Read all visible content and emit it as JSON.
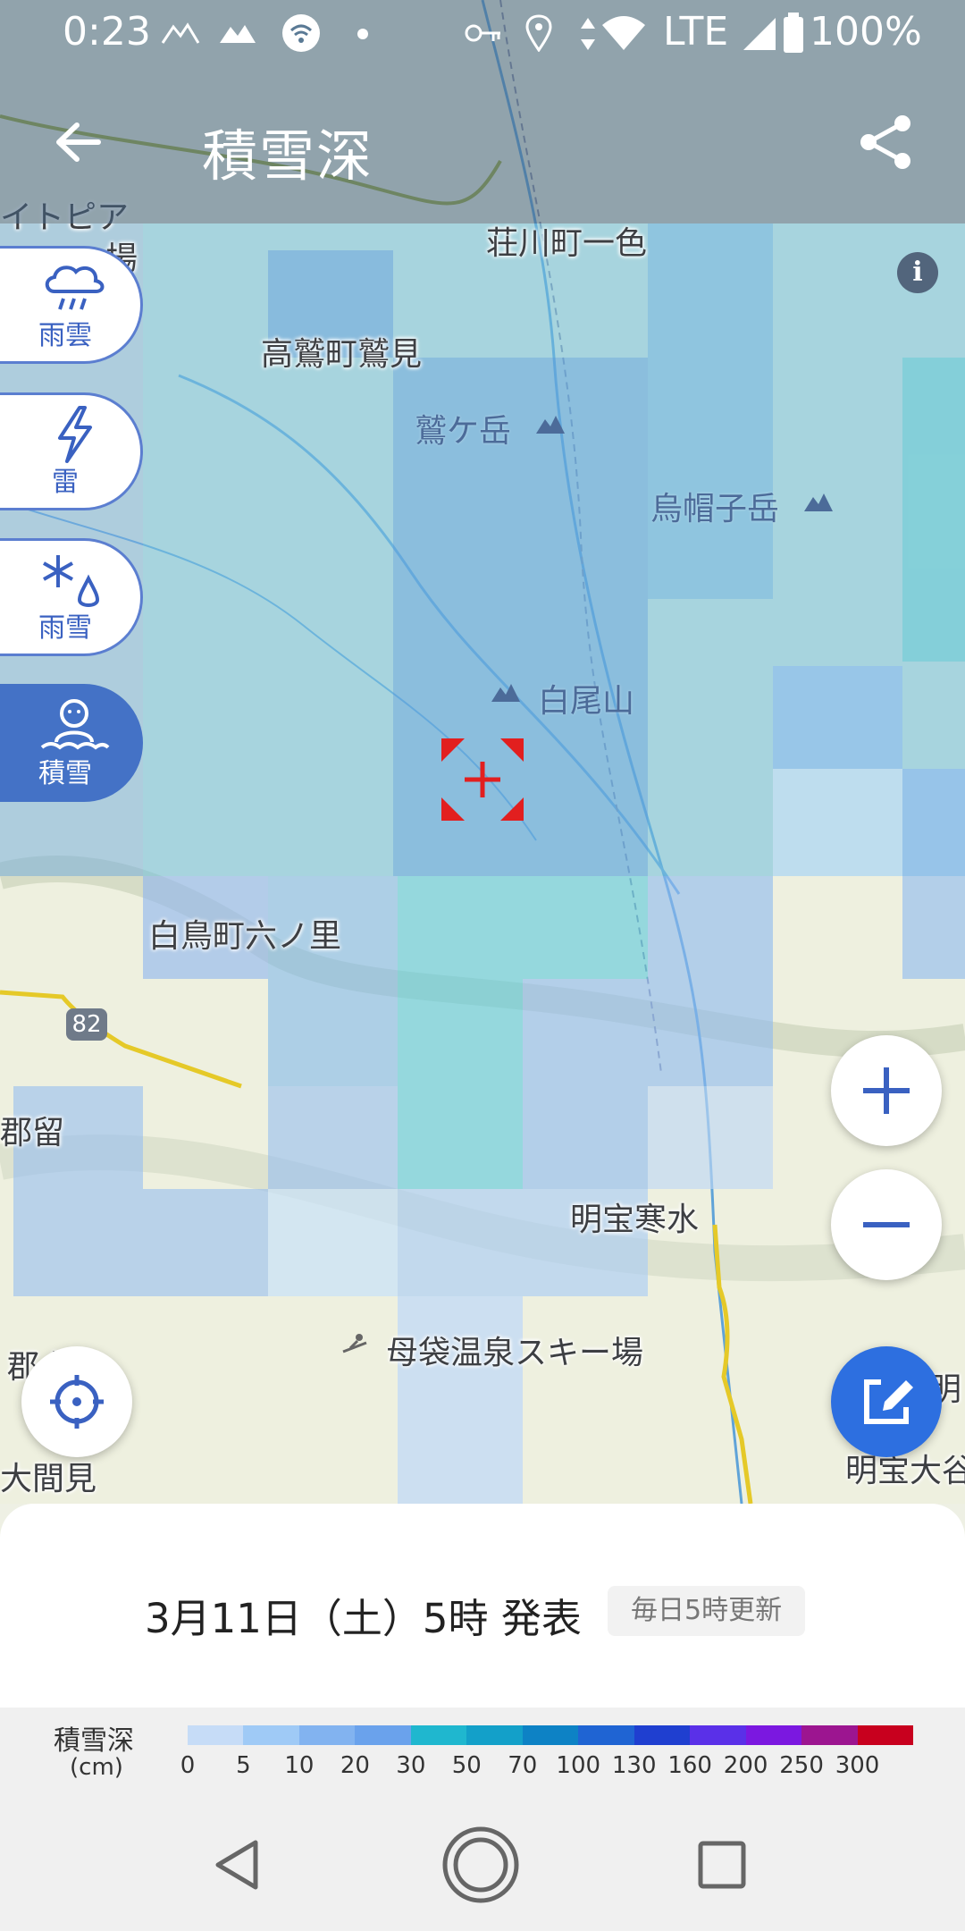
{
  "status_bar": {
    "time": "0:23",
    "network": "LTE",
    "battery": "100%"
  },
  "header": {
    "title": "積雪深"
  },
  "map_labels": [
    {
      "text": "荘川町一色",
      "type": "town"
    },
    {
      "text": "高鷲町鷲見",
      "type": "town"
    },
    {
      "text": "鷲ケ岳",
      "type": "peak"
    },
    {
      "text": "烏帽子岳",
      "type": "peak"
    },
    {
      "text": "白尾山",
      "type": "peak"
    },
    {
      "text": "白鳥町六ノ里",
      "type": "town"
    },
    {
      "text": "明宝寒水",
      "type": "town"
    },
    {
      "text": "母袋温泉スキー場",
      "type": "town"
    },
    {
      "text": "郡留",
      "type": "town"
    },
    {
      "text": "郡上",
      "type": "town"
    },
    {
      "text": "大間見",
      "type": "town"
    },
    {
      "text": "明宝大谷",
      "type": "town"
    },
    {
      "text": "明",
      "type": "town"
    },
    {
      "text": "イトピア",
      "type": "town"
    },
    {
      "text": "場",
      "type": "town"
    },
    {
      "text": "82",
      "type": "route"
    }
  ],
  "layer_tabs": [
    {
      "label": "雨雲",
      "icon": "rain-cloud-icon",
      "active": false
    },
    {
      "label": "雷",
      "icon": "lightning-icon",
      "active": false
    },
    {
      "label": "雨雪",
      "icon": "snow-rain-icon",
      "active": false
    },
    {
      "label": "積雪",
      "icon": "snowman-icon",
      "active": true
    }
  ],
  "info": {
    "label": "i"
  },
  "sheet": {
    "published": "3月11日（土）5時 発表",
    "update_badge": "毎日5時更新"
  },
  "legend": {
    "name": "積雪深",
    "unit": "(cm)",
    "ticks": [
      "0",
      "5",
      "10",
      "20",
      "30",
      "50",
      "70",
      "100",
      "130",
      "160",
      "200",
      "250",
      "300"
    ],
    "colors": [
      "#c6dcf7",
      "#9fcaf6",
      "#82b3f0",
      "#6aa2ec",
      "#1fb7cf",
      "#13a0c9",
      "#0d82c5",
      "#1f64d3",
      "#1f3fd0",
      "#5a30e8",
      "#7b18e0",
      "#9c1590",
      "#c8001e"
    ]
  }
}
